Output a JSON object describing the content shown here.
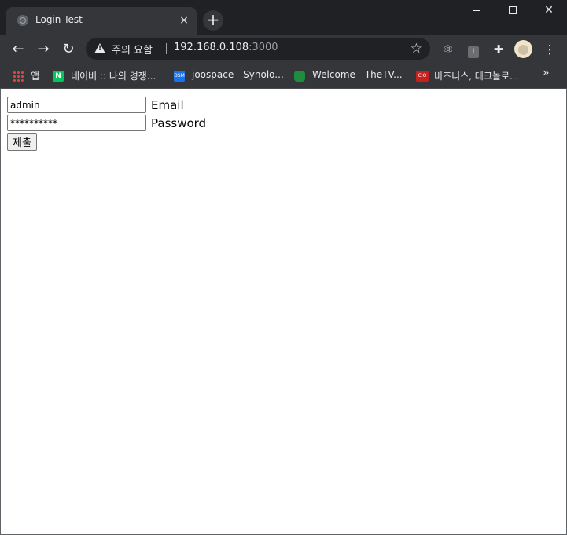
{
  "browser": {
    "tab_title": "Login Test",
    "tab_close": "×",
    "new_tab": "+",
    "nav": {
      "back": "←",
      "forward": "→",
      "reload": "↻"
    },
    "omnibox": {
      "security_warning": "주의 요함",
      "host": "192.168.0.108",
      "port": ":3000",
      "star": "☆"
    },
    "menu": "⋮",
    "extension_box_label": "I"
  },
  "bookmarks": [
    {
      "label": "앱",
      "icon": "apps-grid-icon"
    },
    {
      "label": "네이버 :: 나의 경쟁...",
      "icon": "naver-icon",
      "icon_text": "N"
    },
    {
      "label": "joospace - Synolo...",
      "icon": "dsm-icon",
      "icon_text": "DSM"
    },
    {
      "label": "Welcome - TheTV...",
      "icon": "tvdb-icon"
    },
    {
      "label": "비즈니스, 테크놀로...",
      "icon": "cio-icon",
      "icon_text": "CIO"
    }
  ],
  "bookmarks_more": "»",
  "form": {
    "email_value": "admin",
    "email_label": "Email",
    "password_value": "**********",
    "password_label": "Password",
    "submit_label": "제출"
  },
  "colors": {
    "tabstrip": "#202124",
    "toolbar": "#35363a",
    "page_bg": "#ffffff"
  }
}
